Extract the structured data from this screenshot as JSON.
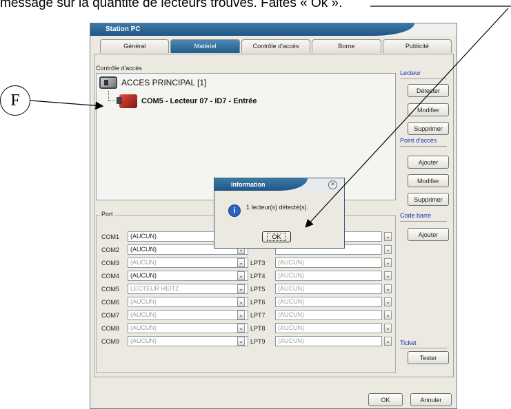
{
  "caption": "message sur la quantité de lecteurs trouvés. Faites « Ok ».",
  "window": {
    "title": "Station PC",
    "tabs": [
      {
        "label": "Général",
        "active": false
      },
      {
        "label": "Matériel",
        "active": true
      },
      {
        "label": "Contrôle d'accès",
        "active": false
      },
      {
        "label": "Borne",
        "active": false
      },
      {
        "label": "Publicité",
        "active": false
      }
    ]
  },
  "access_control": {
    "group_label": "Contrôle d'accès",
    "root": "ACCES PRINCIPAL [1]",
    "child": "COM5 - Lecteur 07 - ID7 - Entrée"
  },
  "right_panel": {
    "lecteur_label": "Lecteur",
    "detect_button": "Détecter",
    "modify_button": "Modifier",
    "delete_button": "Supprimer",
    "point_label": "Point d'accès",
    "point_add_button": "Ajouter",
    "point_modify_button": "Modifier",
    "point_delete_button": "Supprimer",
    "barcode_label": "Code barre",
    "barcode_add_button": "Ajouter",
    "ticket_label": "Ticket",
    "test_button": "Tester"
  },
  "ports": {
    "group_label": "Port",
    "com": [
      {
        "label": "COM1",
        "value": "(AUCUN)",
        "enabled": true
      },
      {
        "label": "COM2",
        "value": "(AUCUN)",
        "enabled": true
      },
      {
        "label": "COM3",
        "value": "(AUCUN)",
        "enabled": false
      },
      {
        "label": "COM4",
        "value": "(AUCUN)",
        "enabled": true
      },
      {
        "label": "COM5",
        "value": "LECTEUR HEITZ",
        "enabled": false
      },
      {
        "label": "COM6",
        "value": "(AUCUN)",
        "enabled": false
      },
      {
        "label": "COM7",
        "value": "(AUCUN)",
        "enabled": false
      },
      {
        "label": "COM8",
        "value": "(AUCUN)",
        "enabled": false
      },
      {
        "label": "COM9",
        "value": "(AUCUN)",
        "enabled": false
      }
    ],
    "lpt": [
      {
        "label": "",
        "value": "",
        "enabled": true
      },
      {
        "label": "",
        "value": "",
        "enabled": true
      },
      {
        "label": "LPT3",
        "value": "(AUCUN)",
        "enabled": false
      },
      {
        "label": "LPT4",
        "value": "(AUCUN)",
        "enabled": false
      },
      {
        "label": "LPT5",
        "value": "(AUCUN)",
        "enabled": false
      },
      {
        "label": "LPT6",
        "value": "(AUCUN)",
        "enabled": false
      },
      {
        "label": "LPT7",
        "value": "(AUCUN)",
        "enabled": false
      },
      {
        "label": "LPT8",
        "value": "(AUCUN)",
        "enabled": false
      },
      {
        "label": "LPT9",
        "value": "(AUCUN)",
        "enabled": false
      }
    ]
  },
  "footer": {
    "ok_button": "OK",
    "cancel_button": "Annuler"
  },
  "dialog": {
    "title": "Information",
    "message": "1 lecteur(s) détecté(s).",
    "ok_button": "OK"
  },
  "annotation": {
    "callout_letter": "F"
  }
}
